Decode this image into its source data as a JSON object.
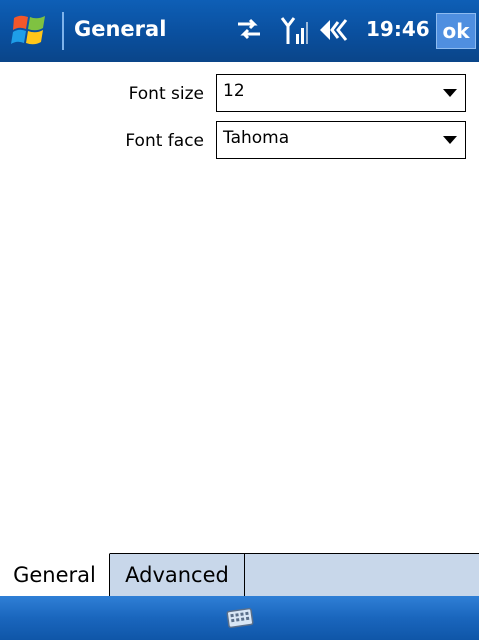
{
  "titlebar": {
    "title": "General",
    "clock": "19:46",
    "ok_label": "ok",
    "icons": [
      "start-logo",
      "connectivity-icon",
      "signal-icon",
      "volume-icon"
    ]
  },
  "form": {
    "font_size_label": "Font size",
    "font_size_value": "12",
    "font_face_label": "Font face",
    "font_face_value": "Tahoma"
  },
  "tabs": [
    {
      "label": "General",
      "selected": true
    },
    {
      "label": "Advanced",
      "selected": false
    }
  ],
  "bottombar": {
    "icon": "keyboard-icon"
  },
  "colors": {
    "titlebar": "#0a4f9e",
    "tabstrip": "#c8d7ea",
    "bottombar": "#1a66bd"
  }
}
